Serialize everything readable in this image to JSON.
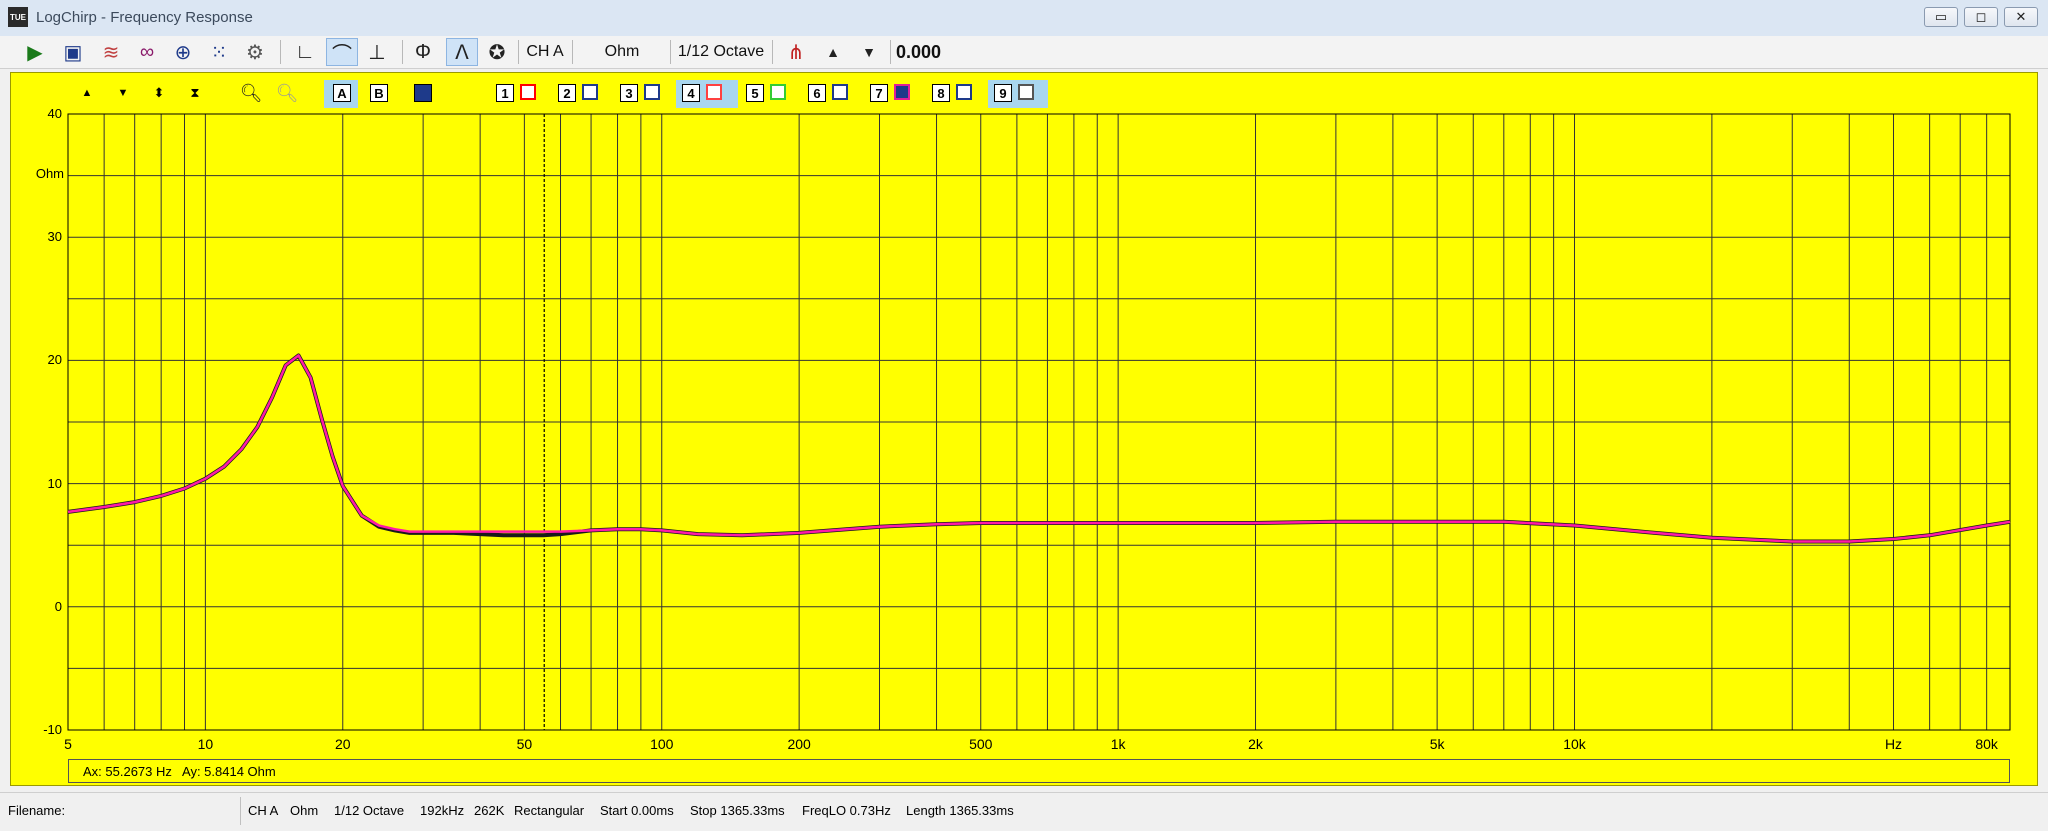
{
  "window": {
    "title": "LogChirp - Frequency Response",
    "app_icon_text": "TUE"
  },
  "toolbar": {
    "channel": "CH A",
    "unit": "Ohm",
    "smoothing": "1/12 Octave",
    "value": "0.000",
    "icons": [
      "play-icon",
      "save-icon",
      "waterfall-icon",
      "infinity-icon",
      "mic-icon",
      "dots-icon",
      "settings-icon",
      "axis-icon",
      "curve-icon",
      "phase-icon",
      "phi-icon",
      "response-icon",
      "dial-icon",
      "marker-icon",
      "up-arrow-icon",
      "down-arrow-icon"
    ]
  },
  "plot_controls": {
    "buttons": [
      "A",
      "B"
    ],
    "memories": [
      "1",
      "2",
      "3",
      "4",
      "5",
      "6",
      "7",
      "8",
      "9"
    ],
    "memory_colors": [
      "#ff0000",
      "#1e3a8a",
      "#1e3a8a",
      "#ff4040",
      "#33cc33",
      "#1e3a8a",
      "#e0209a",
      "#1e3a8a",
      "#555555"
    ]
  },
  "readout": {
    "ax": "Ax: 55.2673 Hz",
    "ay": "Ay: 5.8414 Ohm"
  },
  "status": {
    "filename": "Filename:",
    "channel": "CH A",
    "unit": "Ohm",
    "smoothing": "1/12 Octave",
    "rate": "192kHz",
    "size": "262K",
    "window": "Rectangular",
    "start": "Start 0.00ms",
    "stop": "Stop 1365.33ms",
    "freqlo": "FreqLO 0.73Hz",
    "length": "Length 1365.33ms"
  },
  "chart_data": {
    "type": "line",
    "x_scale": "log",
    "xlim": [
      5,
      90000
    ],
    "ylim": [
      -10,
      40
    ],
    "ylabel": "Ohm",
    "xlabel": "Hz",
    "y_ticks": [
      "40",
      "30",
      "20",
      "10",
      "0",
      "-10"
    ],
    "x_ticks": [
      {
        "v": 5,
        "label": "5"
      },
      {
        "v": 10,
        "label": "10"
      },
      {
        "v": 20,
        "label": "20"
      },
      {
        "v": 50,
        "label": "50"
      },
      {
        "v": 100,
        "label": "100"
      },
      {
        "v": 200,
        "label": "200"
      },
      {
        "v": 500,
        "label": "500"
      },
      {
        "v": 1000,
        "label": "1k"
      },
      {
        "v": 2000,
        "label": "2k"
      },
      {
        "v": 5000,
        "label": "5k"
      },
      {
        "v": 10000,
        "label": "10k"
      },
      {
        "v": 50000,
        "label": "Hz"
      },
      {
        "v": 80000,
        "label": "80k"
      }
    ],
    "cursor_x": 55.2673,
    "grid": true,
    "colors": {
      "measured": "#1a1a1a",
      "memory": "#ff1aa8",
      "grid": "#333333",
      "background": "#ffff00"
    },
    "series": [
      {
        "x": [
          5,
          6,
          7,
          8,
          9,
          10,
          11,
          12,
          13,
          14,
          15,
          16,
          17,
          18,
          19,
          20,
          22,
          24,
          26,
          28,
          30,
          35,
          40,
          45,
          50,
          55,
          60,
          70,
          80,
          90,
          100,
          120,
          150,
          200,
          300,
          400,
          500,
          700,
          1000,
          2000,
          3000,
          5000,
          7000,
          10000,
          15000,
          20000,
          30000,
          40000,
          50000,
          60000,
          80000,
          90000
        ],
        "values": [
          7.7,
          8.1,
          8.5,
          9.0,
          9.6,
          10.4,
          11.4,
          12.8,
          14.6,
          17.0,
          19.6,
          20.4,
          18.6,
          15.2,
          12.2,
          9.8,
          7.4,
          6.5,
          6.2,
          6.0,
          6.0,
          6.0,
          5.9,
          5.8,
          5.8,
          5.8,
          5.9,
          6.2,
          6.3,
          6.3,
          6.2,
          5.9,
          5.8,
          6.0,
          6.5,
          6.7,
          6.8,
          6.8,
          6.8,
          6.8,
          6.9,
          6.9,
          6.9,
          6.6,
          6.0,
          5.6,
          5.3,
          5.3,
          5.5,
          5.8,
          6.6,
          6.9
        ]
      },
      {
        "x": [
          5,
          6,
          7,
          8,
          9,
          10,
          11,
          12,
          13,
          14,
          15,
          16,
          17,
          18,
          19,
          20,
          22,
          24,
          26,
          28,
          30,
          35,
          40,
          45,
          50,
          55,
          60,
          70,
          80,
          90,
          100,
          120,
          150,
          200,
          300,
          400,
          500,
          700,
          1000,
          2000,
          3000,
          5000,
          7000,
          10000,
          15000,
          20000,
          30000,
          40000,
          50000,
          60000,
          80000,
          90000
        ],
        "values": [
          7.7,
          8.1,
          8.5,
          9.0,
          9.6,
          10.4,
          11.4,
          12.8,
          14.6,
          17.0,
          19.6,
          20.4,
          18.6,
          15.2,
          12.2,
          9.8,
          7.4,
          6.6,
          6.3,
          6.1,
          6.1,
          6.1,
          6.1,
          6.1,
          6.1,
          6.1,
          6.1,
          6.2,
          6.3,
          6.3,
          6.2,
          5.9,
          5.8,
          6.0,
          6.5,
          6.7,
          6.8,
          6.8,
          6.8,
          6.8,
          6.9,
          6.9,
          6.9,
          6.6,
          6.0,
          5.6,
          5.3,
          5.3,
          5.5,
          5.8,
          6.6,
          6.9
        ]
      }
    ]
  }
}
